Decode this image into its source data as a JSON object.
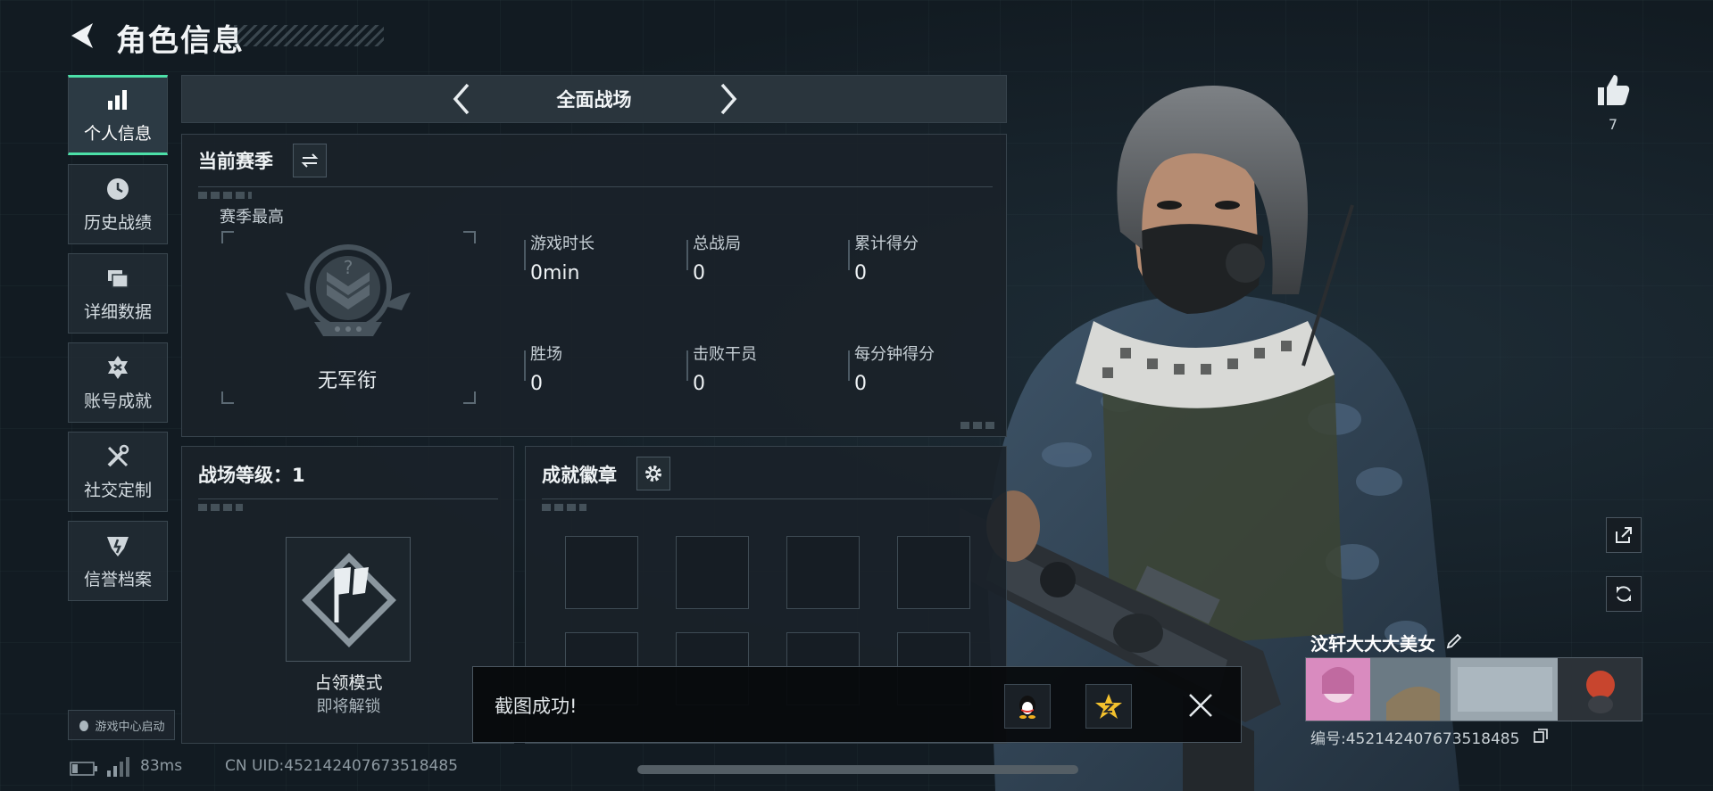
{
  "header": {
    "title": "角色信息"
  },
  "sidebar": {
    "items": [
      {
        "label": "个人信息",
        "icon": "bar-chart-icon"
      },
      {
        "label": "历史战绩",
        "icon": "clock-icon"
      },
      {
        "label": "详细数据",
        "icon": "folder-icon"
      },
      {
        "label": "账号成就",
        "icon": "medal-icon"
      },
      {
        "label": "社交定制",
        "icon": "tools-icon"
      },
      {
        "label": "信誉档案",
        "icon": "emblem-icon"
      }
    ],
    "active_index": 0,
    "game_center_label": "游戏中心启动"
  },
  "mode_bar": {
    "title": "全面战场"
  },
  "season": {
    "title": "当前赛季",
    "best_label": "赛季最高",
    "rank_name": "无军衔",
    "stats": [
      {
        "label": "游戏时长",
        "value": "0min"
      },
      {
        "label": "总战局",
        "value": "0"
      },
      {
        "label": "累计得分",
        "value": "0"
      },
      {
        "label": "胜场",
        "value": "0"
      },
      {
        "label": "击败干员",
        "value": "0"
      },
      {
        "label": "每分钟得分",
        "value": "0"
      }
    ]
  },
  "battlefield_level": {
    "title": "战场等级：1",
    "mode_name": "占领模式",
    "mode_status": "即将解锁"
  },
  "achievements": {
    "title": "成就徽章"
  },
  "toast": {
    "text": "截图成功!",
    "share_targets": [
      "qq-icon",
      "qzone-icon"
    ]
  },
  "status_bar": {
    "latency": "83ms",
    "uid": "CN UID:452142407673518485"
  },
  "profile": {
    "name": "汶轩大大大美女",
    "id_text": "编号:452142407673518485",
    "likes": "7"
  },
  "colors": {
    "accent": "#4ce0a8",
    "background": "#121b22",
    "panel": "#1a2229"
  }
}
